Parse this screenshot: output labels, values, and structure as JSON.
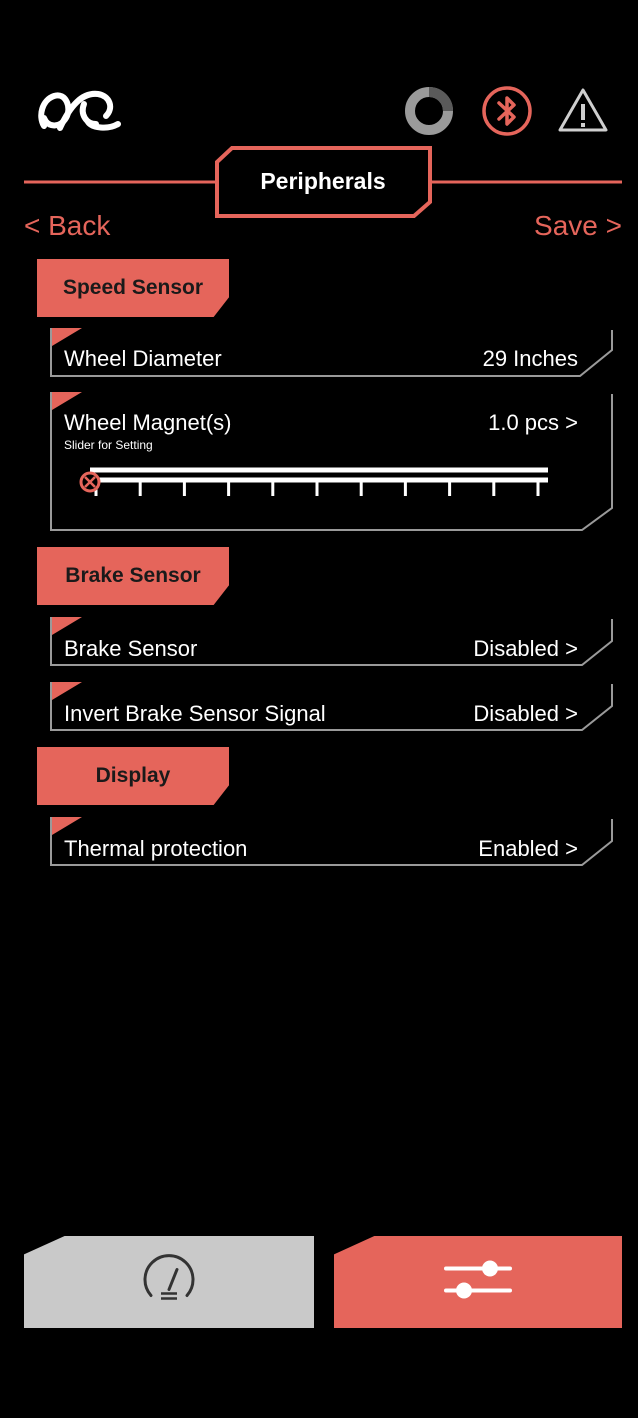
{
  "header": {
    "title": "Peripherals",
    "back_label": "< Back",
    "save_label": "Save >"
  },
  "icons": {
    "logo": "brand-logo-icon",
    "status_ring": "progress-ring-icon",
    "bluetooth": "bluetooth-icon",
    "warning": "warning-icon",
    "dashboard_tab": "speedometer-icon",
    "settings_tab": "sliders-icon"
  },
  "colors": {
    "accent": "#e5655b",
    "background": "#000000",
    "inactive_tab": "#c9c9c9"
  },
  "sections": [
    {
      "title": "Speed Sensor",
      "rows": [
        {
          "label": "Wheel Diameter",
          "value": "29 Inches"
        },
        {
          "label": "Wheel Magnet(s)",
          "value": "1.0 pcs >",
          "sublabel": "Slider for Setting"
        }
      ]
    },
    {
      "title": "Brake Sensor",
      "rows": [
        {
          "label": "Brake Sensor",
          "value": "Disabled >"
        },
        {
          "label": "Invert Brake Sensor Signal",
          "value": "Disabled >"
        }
      ]
    },
    {
      "title": "Display",
      "rows": [
        {
          "label": "Thermal protection",
          "value": "Enabled >"
        }
      ]
    }
  ],
  "slider": {
    "level": 0.0,
    "ticks": 11
  }
}
